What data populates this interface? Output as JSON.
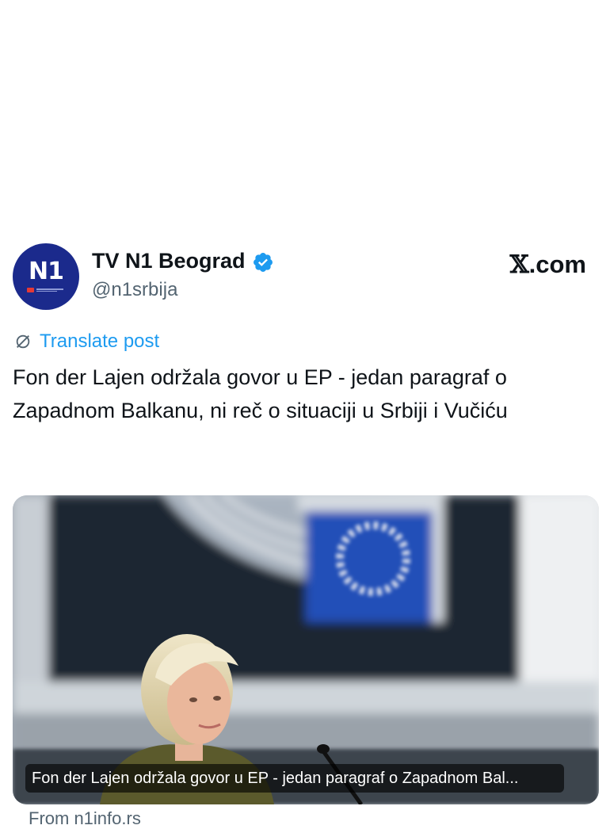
{
  "author": {
    "display_name": "TV N1 Beograd",
    "handle": "@n1srbija",
    "avatar_logo": "N1",
    "verified": true,
    "verified_color": "#1d9bf0"
  },
  "site_badge": {
    "x_glyph": "𝕏",
    "text": ".com"
  },
  "translate": {
    "label": "Translate post",
    "icon": "globe-slash-icon"
  },
  "post": {
    "text": "Fon der Lajen održala govor u EP - jedan paragraf o Zapadnom Balkanu, ni reč o situaciji u Srbiji i Vučiću"
  },
  "media_card": {
    "caption": "Fon der Lajen održala govor u EP - jedan paragraf o Zapadnom Bal...",
    "source": "From n1info.rs"
  },
  "colors": {
    "link": "#1d9bf0",
    "secondary_text": "#536471",
    "primary_text": "#0f1419",
    "n1_brand": "#1b2a8c"
  }
}
